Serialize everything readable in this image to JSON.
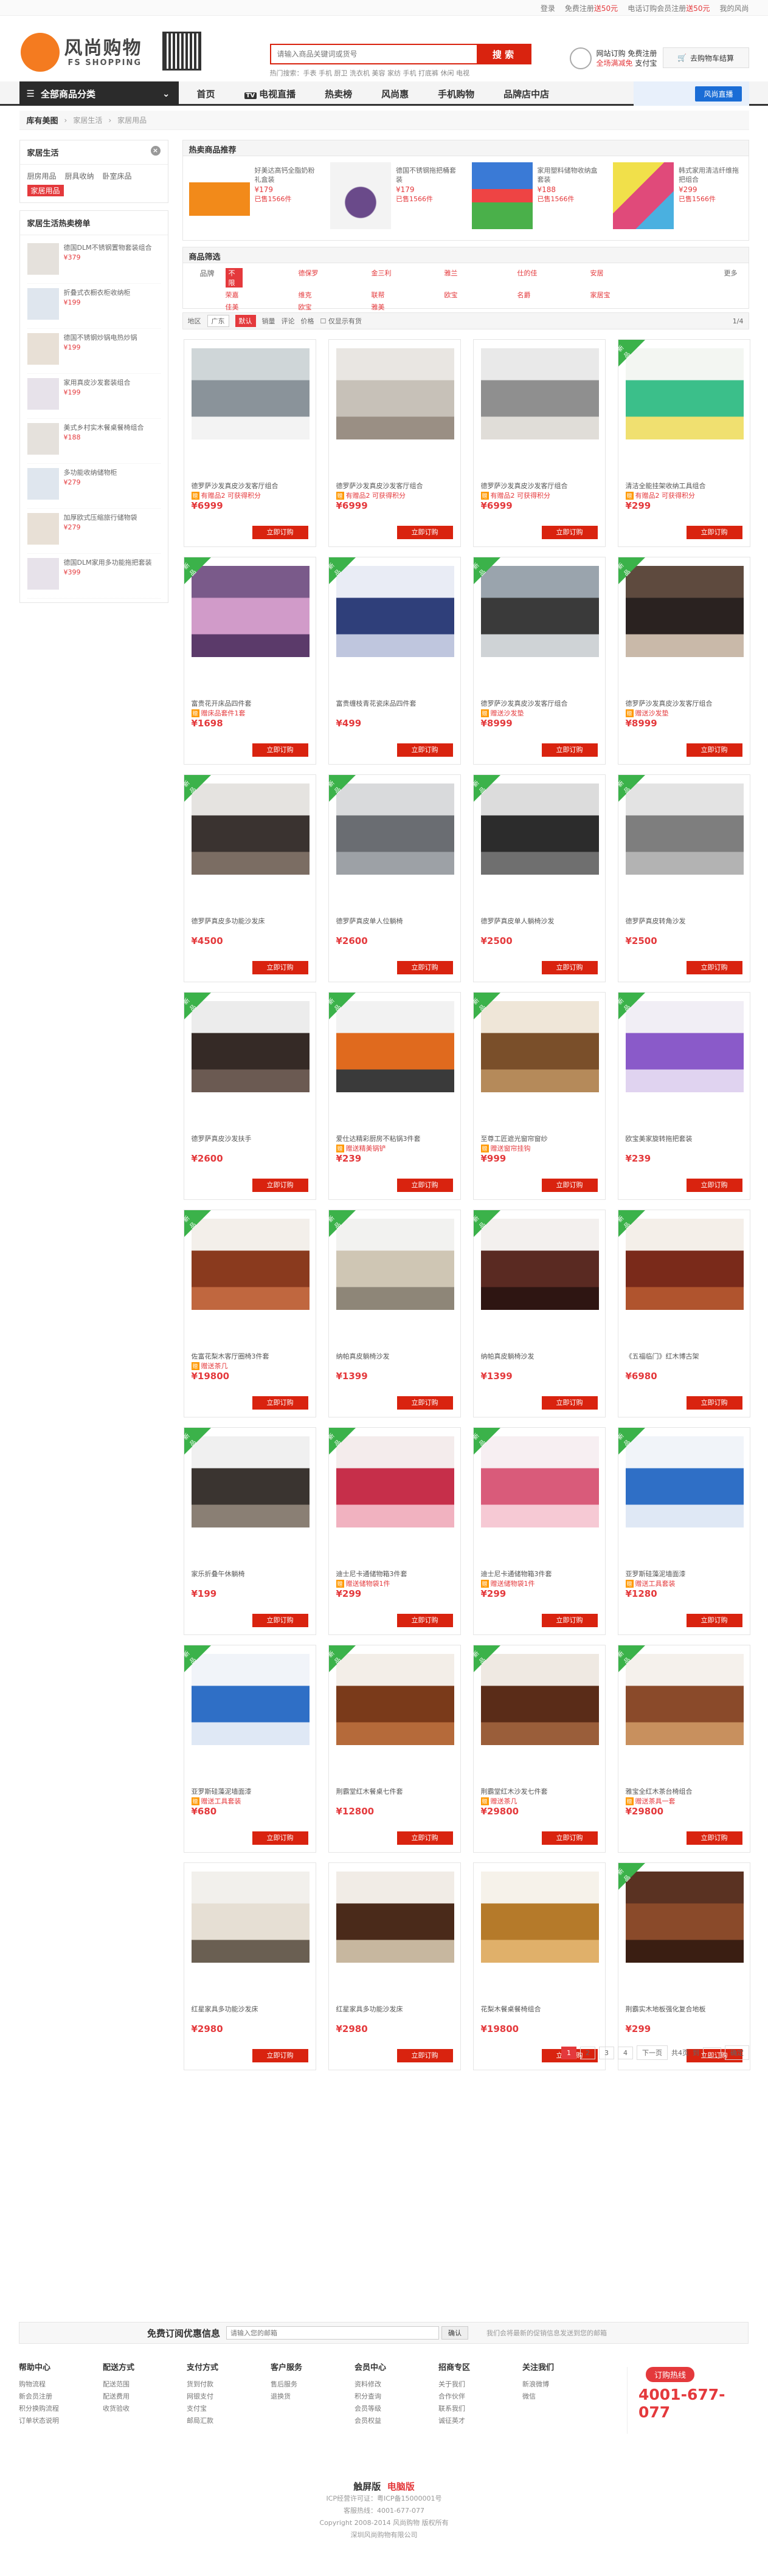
{
  "topbar": {
    "login": "登录",
    "register_prefix": "免费注册",
    "register_bonus": "送50元",
    "phone_prefix": "电话订购会员注册",
    "phone_bonus": "送50元",
    "my": "我的风尚"
  },
  "header": {
    "logo_cn": "风尚购物",
    "logo_en": "FS SHOPPING",
    "search_placeholder": "请输入商品关键词或货号",
    "search_button": "搜 索",
    "hot_words": "热门搜索：手表 手机 厨卫 洗衣机 美容 家纺 手机 打底裤 休闲 电视",
    "promo_line1": "网站订购",
    "promo_line1b": "免费注册",
    "promo_line2": "全场满减免",
    "promo_line2b": "支付宝",
    "cart": "去购物车结算"
  },
  "nav": {
    "all": "全部商品分类",
    "items": [
      "首页",
      "电视直播",
      "热卖榜",
      "风尚惠",
      "手机购物",
      "品牌店中店"
    ],
    "tv_badge": "TV",
    "right_button": "风尚直播"
  },
  "breadcrumb": {
    "home": "库有美图",
    "level1": "家居生活",
    "level2": "家居用品"
  },
  "sidebar": {
    "category_title": "家居生活",
    "tags": [
      "厨房用品",
      "厨具收纳",
      "卧室床品",
      "家居用品"
    ],
    "hot_title": "家居生活热卖榜单",
    "hot_items": [
      {
        "name": "德国DLM不锈钢置物套装组合",
        "price": "¥379"
      },
      {
        "name": "折叠式衣橱衣柜收纳柜",
        "price": "¥199"
      },
      {
        "name": "德国不锈钢炒锅电热炒锅",
        "price": "¥199"
      },
      {
        "name": "家用真皮沙发套装组合",
        "price": "¥199"
      },
      {
        "name": "美式乡村实木餐桌餐椅组合",
        "price": "¥188"
      },
      {
        "name": "多功能收纳储物柜",
        "price": "¥279"
      },
      {
        "name": "加厚欧式压缩旅行储物袋",
        "price": "¥279"
      },
      {
        "name": "德国DLM家用多功能拖把套装",
        "price": "¥399"
      }
    ]
  },
  "recommend": {
    "title": "热卖商品推荐",
    "items": [
      {
        "name": "好美达高钙全脂奶粉礼盒装",
        "price": "¥179",
        "sold": "已售1566件"
      },
      {
        "name": "德国不锈钢拖把桶套装",
        "price": "¥179",
        "sold": "已售1566件"
      },
      {
        "name": "家用塑料储物收纳盒套装",
        "price": "¥188",
        "sold": "已售1566件"
      },
      {
        "name": "韩式家用清洁纤维拖把组合",
        "price": "¥299",
        "sold": "已售1566件"
      }
    ]
  },
  "filter": {
    "title": "商品筛选",
    "brand_label": "品牌",
    "brands": [
      "不限",
      "德保罗",
      "金三利",
      "雅兰",
      "仕的佳",
      "安居",
      "荣嘉",
      "维克",
      "联帮",
      "欧宝",
      "名爵",
      "家居宝",
      "佳美",
      "欧宝",
      "雅美"
    ],
    "more": "更多"
  },
  "sortbar": {
    "region": "地区",
    "region_value": "广东",
    "sort_default": "默认",
    "sort_sales": "销量",
    "sort_comment": "评论",
    "sort_price": "价格",
    "only_stock": "仅显示有货",
    "page_info": "1/4"
  },
  "products": [
    {
      "name": "德罗萨沙发真皮沙发客厅组合",
      "gift": "有赠品2 可获得积分",
      "price": "¥6999",
      "new": false,
      "colors": [
        "#cfd6d8",
        "#8a939a",
        "#f3f3f3"
      ]
    },
    {
      "name": "德罗萨沙发真皮沙发客厅组合",
      "gift": "有赠品2 可获得积分",
      "price": "¥6999",
      "new": false,
      "colors": [
        "#e9e6e2",
        "#c7c1b8",
        "#9a8f84"
      ]
    },
    {
      "name": "德罗萨沙发真皮沙发客厅组合",
      "gift": "有赠品2 可获得积分",
      "price": "¥6999",
      "new": false,
      "colors": [
        "#e9e9e9",
        "#8f8f8f",
        "#e0ddd8"
      ]
    },
    {
      "name": "清洁全能挂架收纳工具组合",
      "gift": "有赠品2 可获得积分",
      "price": "¥299",
      "new": true,
      "colors": [
        "#f3f6f2",
        "#3bbf8a",
        "#f0e070"
      ]
    },
    {
      "name": "富贵花开床品四件套",
      "gift": "赠床品套件1套",
      "price": "¥1698",
      "new": true,
      "colors": [
        "#7a5a8a",
        "#d19bc9",
        "#5b3a6a"
      ]
    },
    {
      "name": "富贵缠枝青花瓷床品四件套",
      "gift": "",
      "price": "¥499",
      "new": true,
      "colors": [
        "#e9ecf5",
        "#2f3f7a",
        "#bfc6de"
      ]
    },
    {
      "name": "德罗萨沙发真皮沙发客厅组合",
      "gift": "赠送沙发垫",
      "price": "¥8999",
      "new": true,
      "colors": [
        "#9aa4ad",
        "#3a3a3a",
        "#cfd3d6"
      ]
    },
    {
      "name": "德罗萨沙发真皮沙发客厅组合",
      "gift": "赠送沙发垫",
      "price": "¥8999",
      "new": true,
      "colors": [
        "#5e4a3e",
        "#2a2220",
        "#c9b9a9"
      ]
    },
    {
      "name": "德罗萨真皮多功能沙发床",
      "gift": "",
      "price": "¥4500",
      "new": true,
      "colors": [
        "#e5e3e0",
        "#3a3330",
        "#7b6d63"
      ]
    },
    {
      "name": "德罗萨真皮单人位躺椅",
      "gift": "",
      "price": "¥2600",
      "new": true,
      "colors": [
        "#d9dadc",
        "#6a6d72",
        "#9da1a6"
      ]
    },
    {
      "name": "德罗萨真皮单人躺椅沙发",
      "gift": "",
      "price": "¥2500",
      "new": true,
      "colors": [
        "#dcdcdc",
        "#2c2c2c",
        "#6f6f6f"
      ]
    },
    {
      "name": "德罗萨真皮转角沙发",
      "gift": "",
      "price": "¥2500",
      "new": true,
      "colors": [
        "#e3e3e3",
        "#7e7e7e",
        "#b3b3b3"
      ]
    },
    {
      "name": "德罗萨真皮沙发扶手",
      "gift": "",
      "price": "¥2600",
      "new": true,
      "colors": [
        "#ececec",
        "#352a26",
        "#6b5a52"
      ]
    },
    {
      "name": "爱仕达精彩厨房不粘锅3件套",
      "gift": "赠送精美锅铲",
      "price": "¥239",
      "new": true,
      "colors": [
        "#f2f2f2",
        "#e06a1e",
        "#3a3a3a"
      ]
    },
    {
      "name": "至尊工匠遮光窗帘窗纱",
      "gift": "赠送窗帘挂钩",
      "price": "¥999",
      "new": true,
      "colors": [
        "#efe6d8",
        "#7a4f2a",
        "#b58a5a"
      ]
    },
    {
      "name": "欧宝美家旋转拖把套装",
      "gift": "",
      "price": "¥239",
      "new": true,
      "colors": [
        "#f1eef5",
        "#8a5ac9",
        "#e0d3f0"
      ]
    },
    {
      "name": "佐富花梨木客厅圈椅3件套",
      "gift": "赠送茶几",
      "price": "¥19800",
      "new": true,
      "colors": [
        "#f3efea",
        "#8a3a1e",
        "#c0673f"
      ]
    },
    {
      "name": "纳帕真皮躺椅沙发",
      "gift": "",
      "price": "¥1399",
      "new": true,
      "colors": [
        "#f2f2f0",
        "#cfc6b4",
        "#8e8678"
      ]
    },
    {
      "name": "纳帕真皮躺椅沙发",
      "gift": "",
      "price": "¥1399",
      "new": true,
      "colors": [
        "#f3f0ee",
        "#5a2a22",
        "#2e1512"
      ]
    },
    {
      "name": "《五福临门》红木博古架",
      "gift": "",
      "price": "¥6980",
      "new": true,
      "colors": [
        "#f4efe9",
        "#7a2a1a",
        "#b0542e"
      ]
    },
    {
      "name": "家乐折叠午休躺椅",
      "gift": "",
      "price": "¥199",
      "new": true,
      "colors": [
        "#f0f0f0",
        "#3a3430",
        "#8a7f74"
      ]
    },
    {
      "name": "迪士尼卡通储物箱3件套",
      "gift": "赠送储物袋1件",
      "price": "¥299",
      "new": true,
      "colors": [
        "#f4ecec",
        "#c62f4a",
        "#f1b2c0"
      ]
    },
    {
      "name": "迪士尼卡通储物箱3件套",
      "gift": "赠送储物袋1件",
      "price": "¥299",
      "new": true,
      "colors": [
        "#f7eff2",
        "#d95b7a",
        "#f6c9d4"
      ]
    },
    {
      "name": "亚罗斯硅藻泥墙面漆",
      "gift": "赠送工具套装",
      "price": "¥1280",
      "new": true,
      "colors": [
        "#f1f4f9",
        "#2f6fc6",
        "#dfe8f5"
      ]
    },
    {
      "name": "亚罗斯硅藻泥墙面漆",
      "gift": "赠送工具套装",
      "price": "¥680",
      "new": true,
      "colors": [
        "#f1f4f9",
        "#2f6fc6",
        "#dfe8f5"
      ]
    },
    {
      "name": "荆霸堂红木餐桌七件套",
      "gift": "",
      "price": "¥12800",
      "new": true,
      "colors": [
        "#f3eee8",
        "#7a3a1a",
        "#b56a3a"
      ]
    },
    {
      "name": "荆霸堂红木沙发七件套",
      "gift": "赠送茶几",
      "price": "¥29800",
      "new": true,
      "colors": [
        "#efe9e2",
        "#5a2c18",
        "#9a5e3a"
      ]
    },
    {
      "name": "雅宝全红木茶台椅组合",
      "gift": "赠送茶具一套",
      "price": "¥29800",
      "new": true,
      "colors": [
        "#f5f1ec",
        "#8a4a2a",
        "#c8905e"
      ]
    },
    {
      "name": "红星家具多功能沙发床",
      "gift": "",
      "price": "¥2980",
      "new": false,
      "colors": [
        "#f2f0ec",
        "#e6dfd4",
        "#6a5f52"
      ]
    },
    {
      "name": "红星家具多功能沙发床",
      "gift": "",
      "price": "¥2980",
      "new": false,
      "colors": [
        "#f1ece6",
        "#4a2a1a",
        "#c7b79f"
      ]
    },
    {
      "name": "花梨木餐桌餐椅组合",
      "gift": "",
      "price": "¥19800",
      "new": false,
      "colors": [
        "#f6f2ea",
        "#b57a2a",
        "#e0b06a"
      ]
    },
    {
      "name": "荆霸实木地板强化复合地板",
      "gift": "",
      "price": "¥299",
      "new": true,
      "colors": [
        "#5a3222",
        "#8a4a2a",
        "#3a1e12"
      ]
    }
  ],
  "product_button": "立即订购",
  "new_badge": "新品",
  "pager": {
    "pages": [
      "1",
      "2",
      "3",
      "4"
    ],
    "next": "下一页",
    "total": "共4页",
    "goto": "到",
    "go": "确定"
  },
  "subscribe": {
    "title": "免费订阅优惠信息",
    "placeholder": "请输入您的邮箱",
    "button": "确认",
    "note": "我们会将最新的促销信息发送到您的邮箱"
  },
  "footer": {
    "cols": [
      {
        "title": "帮助中心",
        "links": [
          "购物流程",
          "新会员注册",
          "积分换购流程",
          "订单状态说明"
        ]
      },
      {
        "title": "配送方式",
        "links": [
          "配送范围",
          "配送费用",
          "收货验收"
        ]
      },
      {
        "title": "支付方式",
        "links": [
          "货到付款",
          "网银支付",
          "支付宝",
          "邮局汇款"
        ]
      },
      {
        "title": "客户服务",
        "links": [
          "售后服务",
          "退换货"
        ]
      },
      {
        "title": "会员中心",
        "links": [
          "资料修改",
          "积分查询",
          "会员等级",
          "会员权益"
        ]
      },
      {
        "title": "招商专区",
        "links": [
          "关于我们",
          "合作伙伴",
          "联系我们",
          "诚征英才"
        ]
      },
      {
        "title": "关注我们",
        "links": [
          "新浪微博",
          "微信"
        ]
      }
    ],
    "hotline_tag": "订购热线",
    "hotline": "4001-677-077"
  },
  "copyright": {
    "versions_prefix": "触屏版",
    "versions_current": "电脑版",
    "line1": "ICP经营许可证：粤ICP备15000001号",
    "line2": "客服热线：4001-677-077 ",
    "line3": "Copyright 2008-2014 风尚购物 版权所有",
    "line4": "深圳风尚购物有限公司"
  }
}
